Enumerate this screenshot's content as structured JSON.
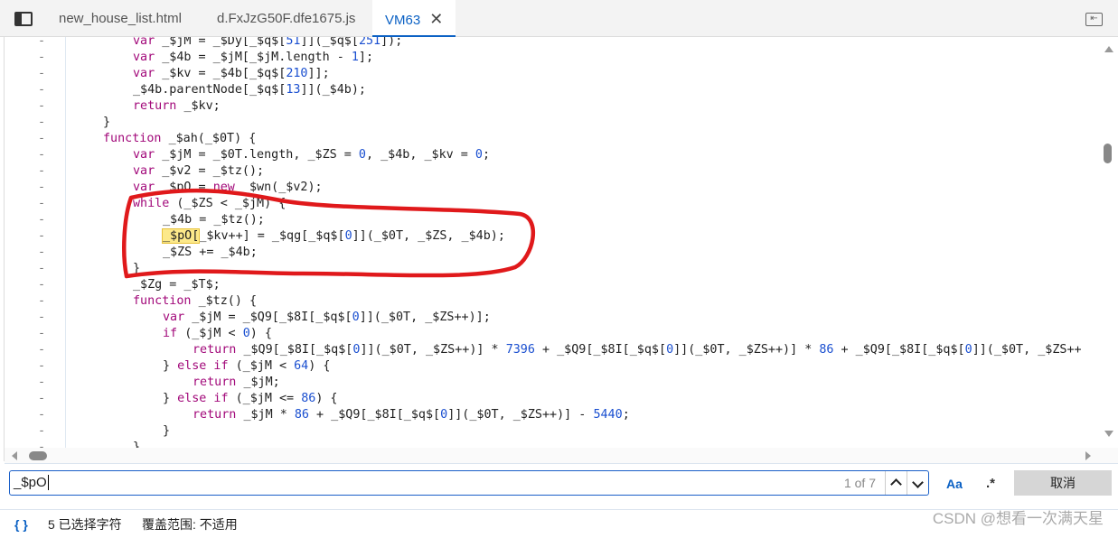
{
  "tabs": {
    "items": [
      {
        "label": "new_house_list.html"
      },
      {
        "label": "d.FxJzG50F.dfe1675.js"
      },
      {
        "label": "VM63"
      }
    ],
    "active": "VM63"
  },
  "code": {
    "lines": [
      {
        "i": 1,
        "t": [
          [
            "k",
            "var "
          ],
          [
            "",
            "_$jM = _$Dy[_$q$["
          ],
          [
            "n",
            "51"
          ],
          [
            "",
            "]](_$q$["
          ],
          [
            "n",
            "251"
          ],
          [
            "",
            "]);"
          ]
        ]
      },
      {
        "i": 1,
        "t": [
          [
            "k",
            "var "
          ],
          [
            "",
            "_$4b = _$jM[_$jM.length - "
          ],
          [
            "n",
            "1"
          ],
          [
            "",
            "];"
          ]
        ]
      },
      {
        "i": 1,
        "t": [
          [
            "k",
            "var "
          ],
          [
            "",
            "_$kv = _$4b[_$q$["
          ],
          [
            "n",
            "210"
          ],
          [
            "",
            "]];"
          ]
        ]
      },
      {
        "i": 1,
        "t": [
          [
            "",
            "_$4b.parentNode[_$q$["
          ],
          [
            "n",
            "13"
          ],
          [
            "",
            "]](_$4b);"
          ]
        ]
      },
      {
        "i": 1,
        "t": [
          [
            "k",
            "return "
          ],
          [
            "",
            "_$kv;"
          ]
        ]
      },
      {
        "i": 0,
        "t": [
          [
            "",
            "}"
          ]
        ]
      },
      {
        "i": 0,
        "t": [
          [
            "k",
            "function "
          ],
          [
            "",
            "_$ah(_$0T) {"
          ]
        ]
      },
      {
        "i": 1,
        "t": [
          [
            "k",
            "var "
          ],
          [
            "",
            "_$jM = _$0T.length, _$ZS = "
          ],
          [
            "n",
            "0"
          ],
          [
            "",
            ", _$4b, _$kv = "
          ],
          [
            "n",
            "0"
          ],
          [
            "",
            ";"
          ]
        ]
      },
      {
        "i": 1,
        "t": [
          [
            "k",
            "var "
          ],
          [
            "",
            "_$v2 = _$tz();"
          ]
        ]
      },
      {
        "i": 1,
        "t": [
          [
            "k",
            "var "
          ],
          [
            "",
            "_$pO = "
          ],
          [
            "k",
            "new "
          ],
          [
            "",
            "_$wn(_$v2);"
          ]
        ]
      },
      {
        "i": 1,
        "t": [
          [
            "k",
            "while "
          ],
          [
            "",
            "(_$ZS < _$jM) {"
          ]
        ]
      },
      {
        "i": 2,
        "t": [
          [
            "",
            "_$4b = _$tz();"
          ]
        ]
      },
      {
        "i": 2,
        "t": [
          [
            "hl",
            "_$pO["
          ],
          [
            "",
            "_$kv++] = _$qg[_$q$["
          ],
          [
            "n",
            "0"
          ],
          [
            "",
            "]](_$0T, _$ZS, _$4b);"
          ]
        ]
      },
      {
        "i": 2,
        "t": [
          [
            "",
            "_$ZS += _$4b;"
          ]
        ]
      },
      {
        "i": 1,
        "t": [
          [
            "",
            "}"
          ]
        ]
      },
      {
        "i": 1,
        "t": [
          [
            "",
            "_$Zg = _$T$;"
          ]
        ]
      },
      {
        "i": 1,
        "t": [
          [
            "k",
            "function "
          ],
          [
            "",
            "_$tz() {"
          ]
        ]
      },
      {
        "i": 2,
        "t": [
          [
            "k",
            "var "
          ],
          [
            "",
            "_$jM = _$Q9[_$8I[_$q$["
          ],
          [
            "n",
            "0"
          ],
          [
            "",
            "]](_$0T, _$ZS++)];"
          ]
        ]
      },
      {
        "i": 2,
        "t": [
          [
            "k",
            "if "
          ],
          [
            "",
            "(_$jM < "
          ],
          [
            "n",
            "0"
          ],
          [
            "",
            ") {"
          ]
        ]
      },
      {
        "i": 3,
        "t": [
          [
            "k",
            "return "
          ],
          [
            "",
            "_$Q9[_$8I[_$q$["
          ],
          [
            "n",
            "0"
          ],
          [
            "",
            "]](_$0T, _$ZS++)] * "
          ],
          [
            "n",
            "7396"
          ],
          [
            "",
            " + _$Q9[_$8I[_$q$["
          ],
          [
            "n",
            "0"
          ],
          [
            "",
            "]](_$0T, _$ZS++)] * "
          ],
          [
            "n",
            "86"
          ],
          [
            "",
            " + _$Q9[_$8I[_$q$["
          ],
          [
            "n",
            "0"
          ],
          [
            "",
            "]](_$0T, _$ZS++"
          ]
        ]
      },
      {
        "i": 2,
        "t": [
          [
            "",
            "} "
          ],
          [
            "k",
            "else if "
          ],
          [
            "",
            "(_$jM < "
          ],
          [
            "n",
            "64"
          ],
          [
            "",
            ") {"
          ]
        ]
      },
      {
        "i": 3,
        "t": [
          [
            "k",
            "return "
          ],
          [
            "",
            "_$jM;"
          ]
        ]
      },
      {
        "i": 2,
        "t": [
          [
            "",
            "} "
          ],
          [
            "k",
            "else if "
          ],
          [
            "",
            "(_$jM <= "
          ],
          [
            "n",
            "86"
          ],
          [
            "",
            ") {"
          ]
        ]
      },
      {
        "i": 3,
        "t": [
          [
            "k",
            "return "
          ],
          [
            "",
            "_$jM * "
          ],
          [
            "n",
            "86"
          ],
          [
            "",
            " + _$Q9[_$8I[_$q$["
          ],
          [
            "n",
            "0"
          ],
          [
            "",
            "]](_$0T, _$ZS++)] - "
          ],
          [
            "n",
            "5440"
          ],
          [
            "",
            ";"
          ]
        ]
      },
      {
        "i": 2,
        "t": [
          [
            "",
            "}"
          ]
        ]
      },
      {
        "i": 1,
        "t": [
          [
            "",
            "}"
          ]
        ]
      }
    ],
    "gutter_marker": "-"
  },
  "search": {
    "value": "_$pO",
    "count": "1 of 7",
    "prev": "^",
    "next": "v",
    "match_case": "Aa",
    "regex": ".*",
    "cancel": "取消"
  },
  "status": {
    "braces": "{ }",
    "selection": "5 已选择字符",
    "coverage": "覆盖范围: 不适用"
  },
  "watermark": "CSDN @想看一次满天星",
  "colors": {
    "accent": "#0b61c4",
    "annotation": "#e0191b",
    "keyword": "#a2097a",
    "number": "#1a4fd0"
  }
}
